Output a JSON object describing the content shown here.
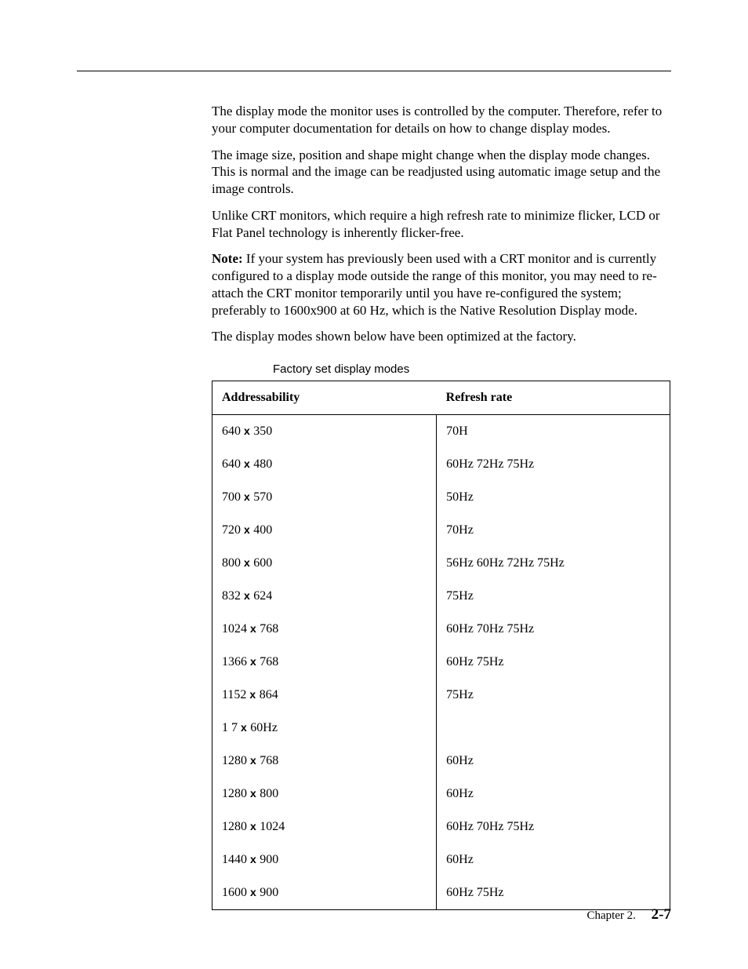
{
  "paragraphs": {
    "p1": "The display mode the monitor uses is controlled by the computer. Therefore, refer to your computer documentation for details on how to change display modes.",
    "p2": "The image size, position and shape might change when the display mode changes. This is normal and the image can be readjusted using automatic image setup and the image controls.",
    "p3": "Unlike CRT monitors, which require a high refresh rate to minimize flicker, LCD or Flat Panel technology is inherently flicker-free.",
    "note_label": "Note:",
    "p4": "  If your system has previously been used with a CRT monitor and is currently configured to a display mode outside the range of this monitor, you may need to re-attach the CRT monitor temporarily until you have re-configured the system; preferably to 1600x900 at 60 Hz, which is the Native Resolution Display mode.",
    "p5": "The display modes shown below have been optimized at the factory."
  },
  "table": {
    "caption": "Factory set display modes",
    "headers": {
      "col1": "Addressability",
      "col2": "Refresh rate"
    },
    "x_glyph": "x",
    "rows": [
      {
        "w": "640",
        "h": "350",
        "rate": "70H"
      },
      {
        "w": "640",
        "h": "480",
        "rate": "60Hz  72Hz  75Hz"
      },
      {
        "w": "700",
        "h": "570",
        "rate": "50Hz"
      },
      {
        "w": "720",
        "h": "400",
        "rate": "70Hz"
      },
      {
        "w": "800",
        "h": "600",
        "rate": "56Hz  60Hz  72Hz  75Hz"
      },
      {
        "w": "832",
        "h": "624",
        "rate": "75Hz"
      },
      {
        "w": "1024",
        "h": "768",
        "rate": "60Hz  70Hz  75Hz"
      },
      {
        "w": "1366",
        "h": "768",
        "rate": "60Hz  75Hz"
      },
      {
        "w": "1152",
        "h": "864",
        "rate": "75Hz"
      },
      {
        "w": "1    7",
        "h": "                                             60Hz",
        "rate": ""
      },
      {
        "w": "1280",
        "h": "768",
        "rate": "60Hz"
      },
      {
        "w": "1280",
        "h": "800",
        "rate": "60Hz"
      },
      {
        "w": "1280",
        "h": "1024",
        "rate": "60Hz  70Hz  75Hz"
      },
      {
        "w": "1440",
        "h": "900",
        "rate": "60Hz"
      },
      {
        "w": "1600",
        "h": "900",
        "rate": "60Hz  75Hz"
      }
    ]
  },
  "footer": {
    "chapter": "Chapter 2.",
    "page": "2-7"
  }
}
